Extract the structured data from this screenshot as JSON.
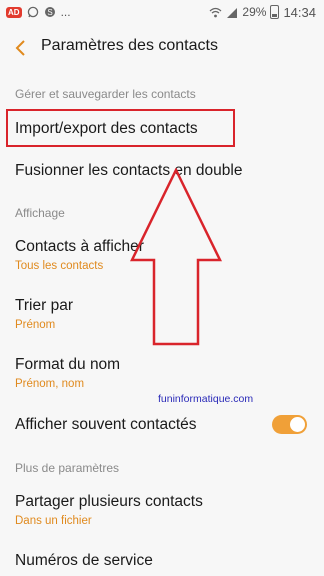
{
  "status_bar": {
    "left_icons": [
      "ad-badge-icon",
      "whatsapp-icon",
      "skype-icon",
      "more-dots-icon"
    ],
    "ad_label": "AD",
    "more_dots": "...",
    "battery": "29%",
    "time": "14:34"
  },
  "header": {
    "title": "Paramètres des contacts"
  },
  "sections": {
    "manage": "Gérer et sauvegarder les contacts",
    "display": "Affichage",
    "more": "Plus de paramètres"
  },
  "items": {
    "import_export": {
      "title": "Import/export des contacts"
    },
    "merge": {
      "title": "Fusionner les contacts en double"
    },
    "contacts_to_show": {
      "title": "Contacts à afficher",
      "value": "Tous les contacts"
    },
    "sort_by": {
      "title": "Trier par",
      "value": "Prénom"
    },
    "name_format": {
      "title": "Format du nom",
      "value": "Prénom, nom"
    },
    "show_frequent": {
      "title": "Afficher souvent contactés",
      "enabled": true
    },
    "share_multiple": {
      "title": "Partager plusieurs contacts",
      "value": "Dans un fichier"
    },
    "service_numbers": {
      "title": "Numéros de service"
    }
  },
  "overlay": {
    "watermark": "funinformatique.com",
    "highlight_color": "#d9242b"
  },
  "colors": {
    "accent": "#e08a1e",
    "toggle_on": "#f0a038",
    "background": "#f7f7f7"
  }
}
